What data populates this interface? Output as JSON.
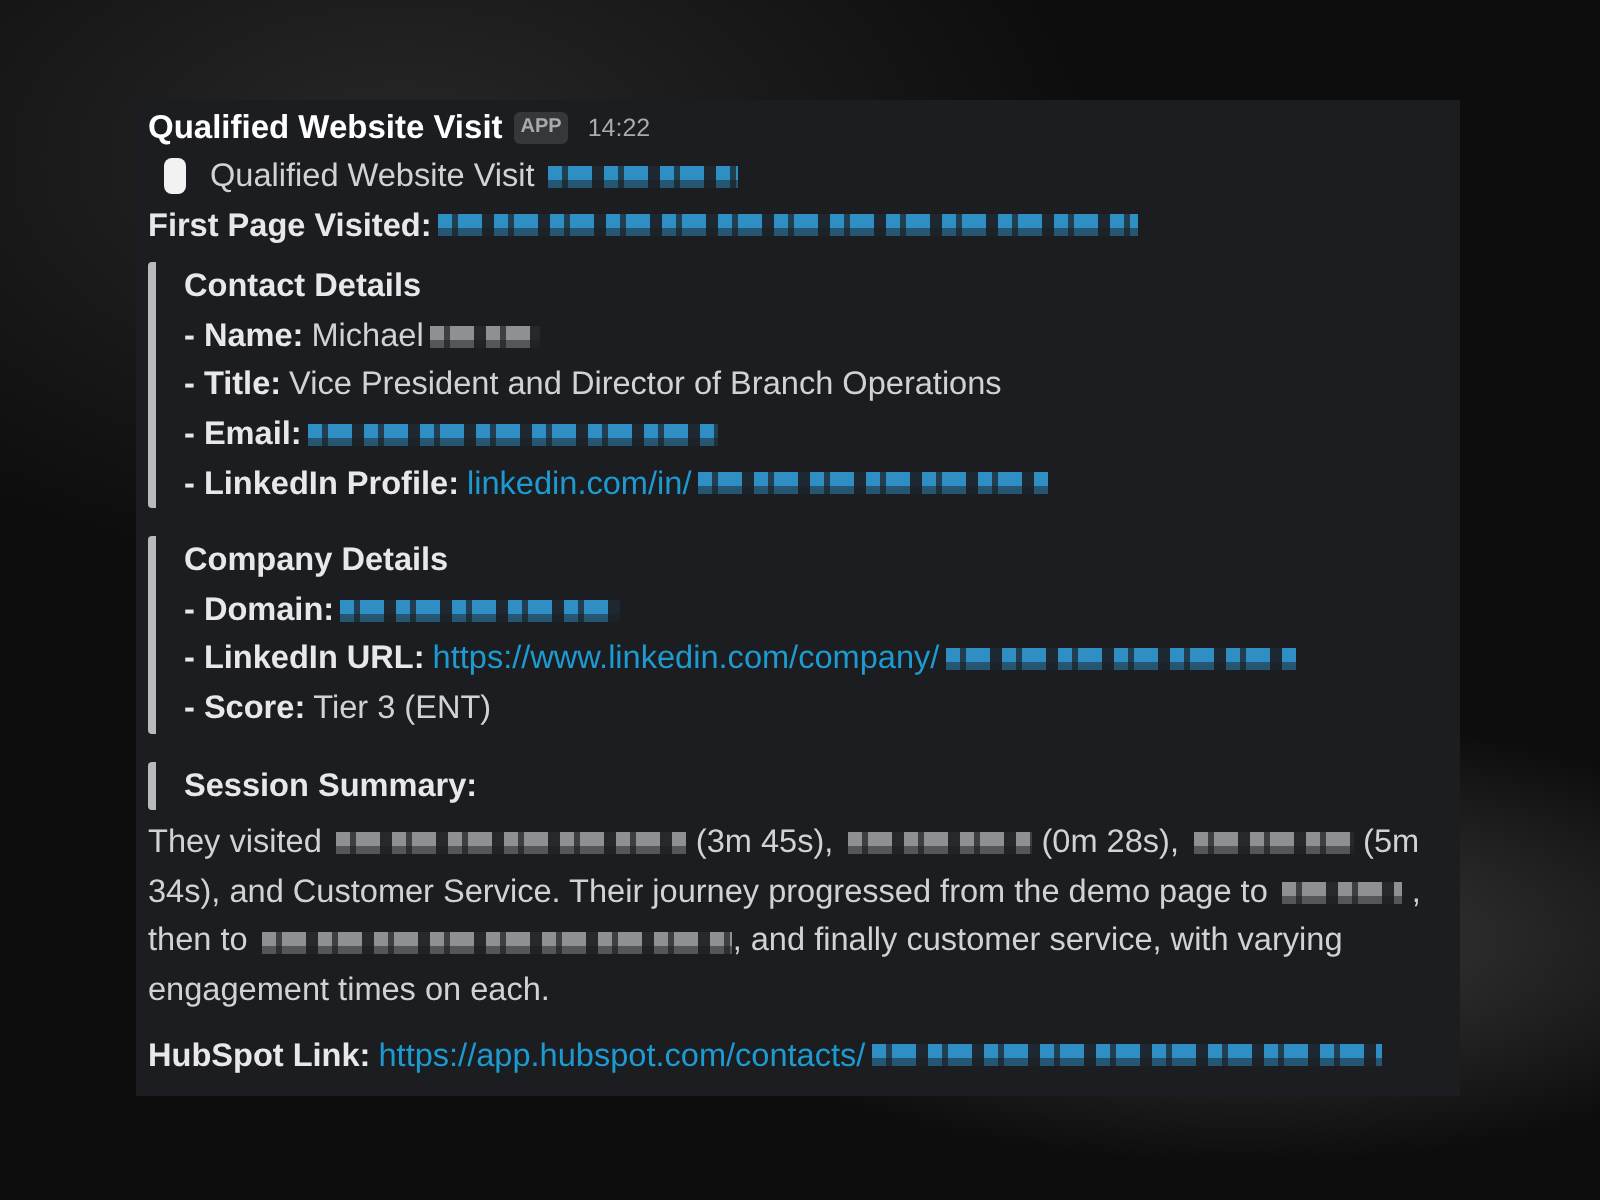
{
  "message": {
    "sender": "Qualified Website Visit",
    "badge": "APP",
    "time": "14:22"
  },
  "subtitle": {
    "text": "Qualified Website Visit",
    "redacted": true
  },
  "first_page": {
    "label": "First Page Visited:",
    "redacted": true
  },
  "sections": [
    {
      "title": "Contact Details",
      "fields": [
        {
          "label": "- Name:",
          "value": "Michael",
          "link": false,
          "redacted": true
        },
        {
          "label": "- Title:",
          "value": "Vice President and Director of Branch Operations",
          "link": false,
          "redacted": false
        },
        {
          "label": "- Email:",
          "link": true,
          "redacted": true
        },
        {
          "label": "- LinkedIn Profile:",
          "value": "linkedin.com/in/",
          "link": true,
          "redacted": true
        }
      ]
    },
    {
      "title": "Company Details",
      "fields": [
        {
          "label": "- Domain:",
          "link": true,
          "redacted": true
        },
        {
          "label": "- LinkedIn URL:",
          "value": "https://www.linkedin.com/company/",
          "link": true,
          "redacted": true
        },
        {
          "label": "- Score:",
          "value": "Tier 3 (ENT)",
          "link": false,
          "redacted": false
        }
      ]
    }
  ],
  "summary": {
    "title": "Session Summary:",
    "segments": [
      {
        "kind": "text",
        "text": "They visited "
      },
      {
        "kind": "redacted"
      },
      {
        "kind": "text",
        "text": " (3m 45s), "
      },
      {
        "kind": "redacted"
      },
      {
        "kind": "text",
        "text": " (0m 28s), "
      },
      {
        "kind": "redacted"
      },
      {
        "kind": "text",
        "text": " (5m 34s), and Customer Service. Their journey progressed from the demo page to "
      },
      {
        "kind": "redacted"
      },
      {
        "kind": "text",
        "text": " , then to "
      },
      {
        "kind": "redacted"
      },
      {
        "kind": "text",
        "text": ", and finally customer service, with varying engagement times on each."
      }
    ]
  },
  "hubspot": {
    "label": "HubSpot Link:",
    "link": "https://app.hubspot.com/contacts/",
    "redacted": true
  }
}
